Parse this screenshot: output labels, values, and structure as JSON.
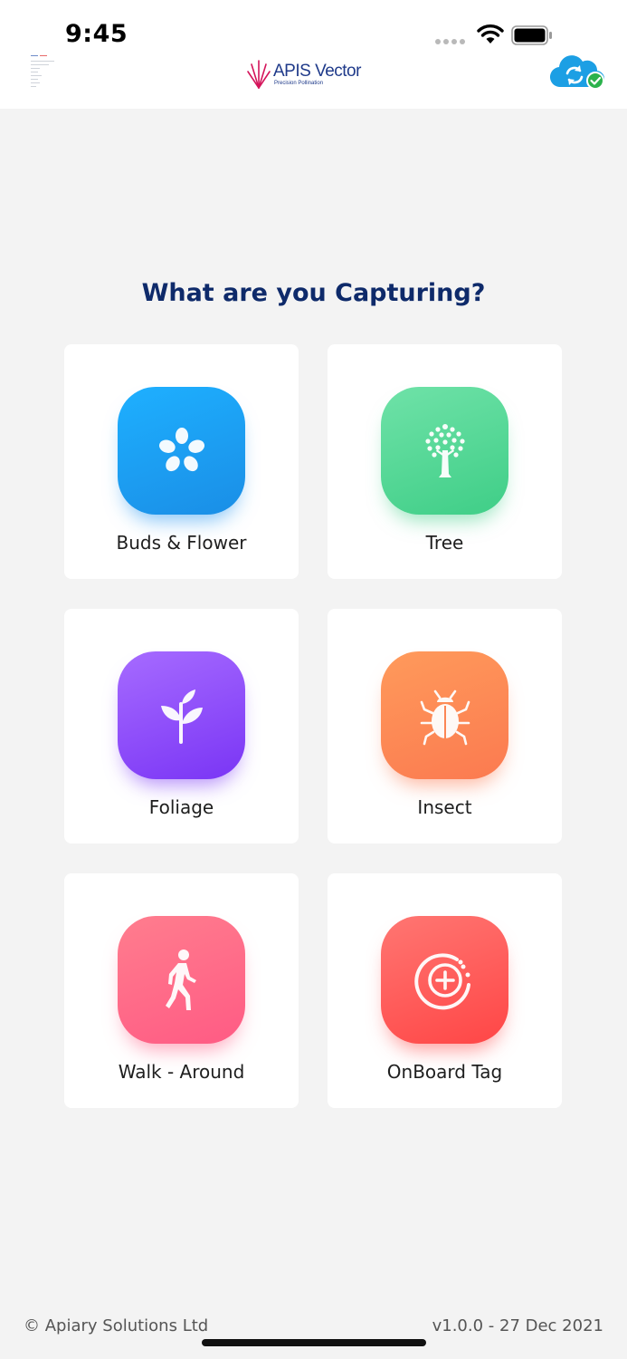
{
  "status_bar": {
    "time": "9:45"
  },
  "header": {
    "logo_text": "APIS Vector",
    "logo_subtitle": "Precision Pollination",
    "brand_color": "#1f3a8a",
    "sync_icon": "cloud-sync-icon",
    "sync_status_icon": "check-badge-icon"
  },
  "main": {
    "title": "What are you Capturing?",
    "tiles": [
      {
        "label": "Buds & Flower",
        "icon": "flower-icon",
        "color": "#1a9ff0"
      },
      {
        "label": "Tree",
        "icon": "tree-icon",
        "color": "#4fd594"
      },
      {
        "label": "Foliage",
        "icon": "sprout-icon",
        "color": "#8a47f8"
      },
      {
        "label": "Insect",
        "icon": "bug-icon",
        "color": "#fc8555"
      },
      {
        "label": "Walk - Around",
        "icon": "walking-person-icon",
        "color": "#ff6a88"
      },
      {
        "label": "OnBoard Tag",
        "icon": "add-tag-icon",
        "color": "#ff5a55"
      }
    ]
  },
  "footer": {
    "copyright": "© Apiary Solutions Ltd",
    "version": "v1.0.0 - 27 Dec 2021"
  }
}
